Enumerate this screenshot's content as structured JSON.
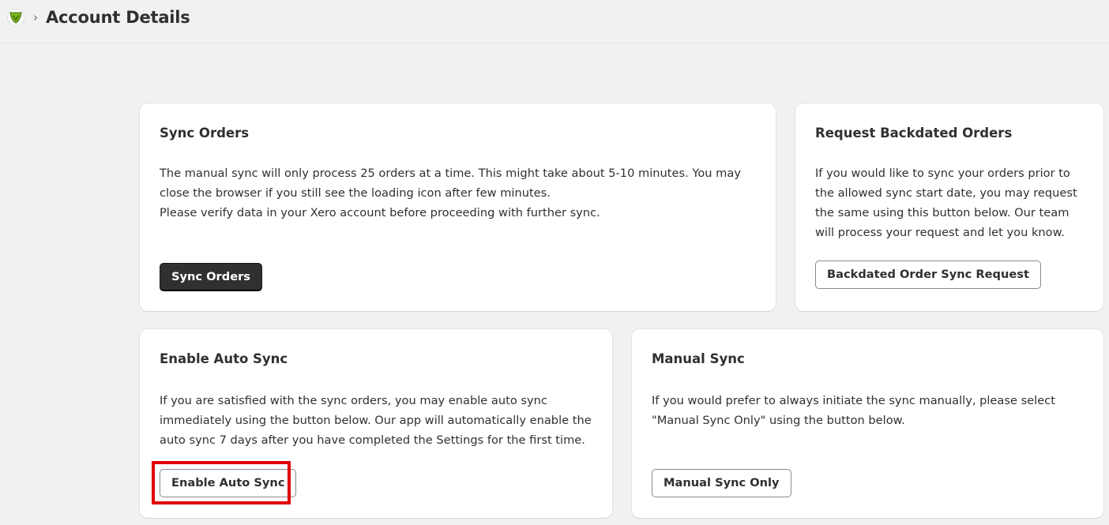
{
  "header": {
    "breadcrumb_separator": "›",
    "title": "Account Details",
    "logo_icon": "app-logo-shield-icon"
  },
  "sync_orders": {
    "title": "Sync Orders",
    "paragraph_1": "The manual sync will only process 25 orders at a time. This might take about 5-10 minutes. You may close the browser if you still see the loading icon after few minutes.",
    "paragraph_2": "Please verify data in your Xero account before proceeding with further sync.",
    "button": "Sync Orders"
  },
  "backdated": {
    "title": "Request Backdated Orders",
    "text": "If you would like to sync your orders prior to the allowed sync start date, you may request the same using this button below. Our team will process your request and let you know.",
    "button": "Backdated Order Sync Request"
  },
  "auto_sync": {
    "title": "Enable Auto Sync",
    "text": "If you are satisfied with the sync orders, you may enable auto sync immediately using the button below. Our app will automatically enable the auto sync 7 days after you have completed the Settings for the first time.",
    "button": "Enable Auto Sync"
  },
  "manual_sync": {
    "title": "Manual Sync",
    "text": "If you would prefer to always initiate the sync manually, please select \"Manual Sync Only\" using the button below.",
    "button": "Manual Sync Only"
  },
  "colors": {
    "highlight": "#e20000",
    "primary_button": "#303030",
    "logo_green": "#7ab51d"
  }
}
